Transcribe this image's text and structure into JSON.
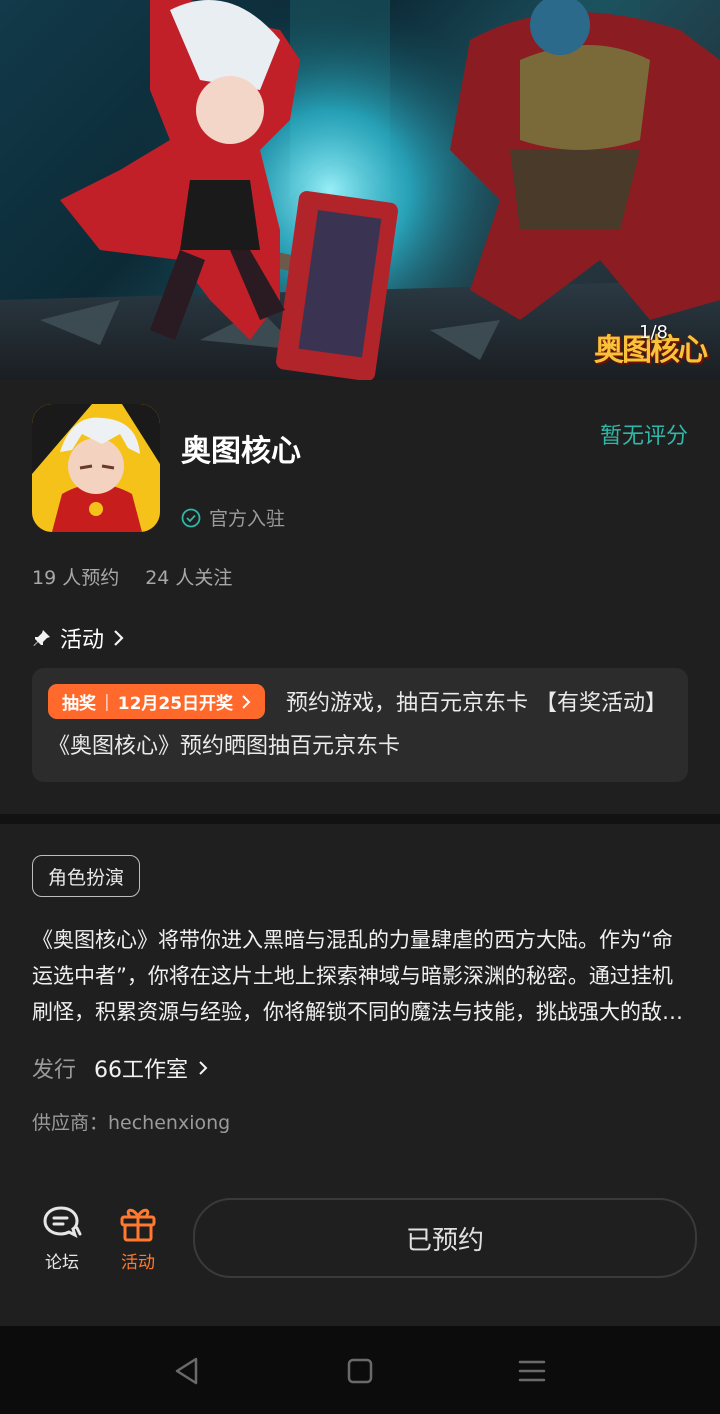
{
  "banner": {
    "counter": "1/8",
    "logo_text": "奥图核心"
  },
  "app": {
    "name": "奥图核心",
    "rating_text": "暂无评分",
    "official_label": "官方入驻",
    "reservations": "19 人预约",
    "followers": "24 人关注"
  },
  "activity": {
    "section_title": "活动",
    "badge_type": "抽奖",
    "badge_date": "12月25日开奖",
    "text": "预约游戏，抽百元京东卡 【有奖活动】《奥图核心》预约晒图抽百元京东卡"
  },
  "details": {
    "tag": "角色扮演",
    "description": "《奥图核心》将带你进入黑暗与混乱的力量肆虐的西方大陆。作为“命运选中者”，你将在这片土地上探索神域与暗影深渊的秘密。通过挂机刷怪，积累资源与经验，你将解锁不同的魔法与技能，挑战强大的敌人。",
    "publisher_label": "发行",
    "publisher_name": "66工作室",
    "supplier": "供应商：hechenxiong"
  },
  "bottom_bar": {
    "forum_label": "论坛",
    "event_label": "活动",
    "reserve_button": "已预约"
  },
  "colors": {
    "accent_teal": "#2fb7a7",
    "accent_orange": "#ff6a2c",
    "background": "#1f1f1f"
  }
}
